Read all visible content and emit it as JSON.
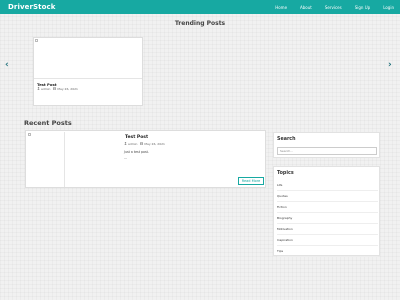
{
  "brand": "DriverStock",
  "nav": [
    "Home",
    "About",
    "Services",
    "Sign Up",
    "Login"
  ],
  "trending": {
    "title": "Trending Posts",
    "prev_arrow": "‹",
    "next_arrow": "›",
    "card": {
      "title": "Test Post",
      "author": "admin",
      "date": "May 26, 2021",
      "author_icon": "user-icon",
      "date_icon": "calendar-icon"
    }
  },
  "recent": {
    "title": "Recent Posts",
    "post": {
      "title": "Test Post",
      "author": "admin",
      "date": "May 26, 2021",
      "excerpt": "Just a test post.",
      "ellipsis": "...",
      "read_more": "Read More"
    }
  },
  "sidebar": {
    "search": {
      "title": "Search",
      "placeholder": "Search..."
    },
    "topics": {
      "title": "Topics",
      "items": [
        "Life",
        "Quotes",
        "Fiction",
        "Biography",
        "Motivation",
        "Inspiration",
        "Tips"
      ]
    }
  },
  "colors": {
    "brand_teal": "#17a9a2",
    "arrow": "#1f6f7a",
    "background": "#f1f1f1"
  }
}
